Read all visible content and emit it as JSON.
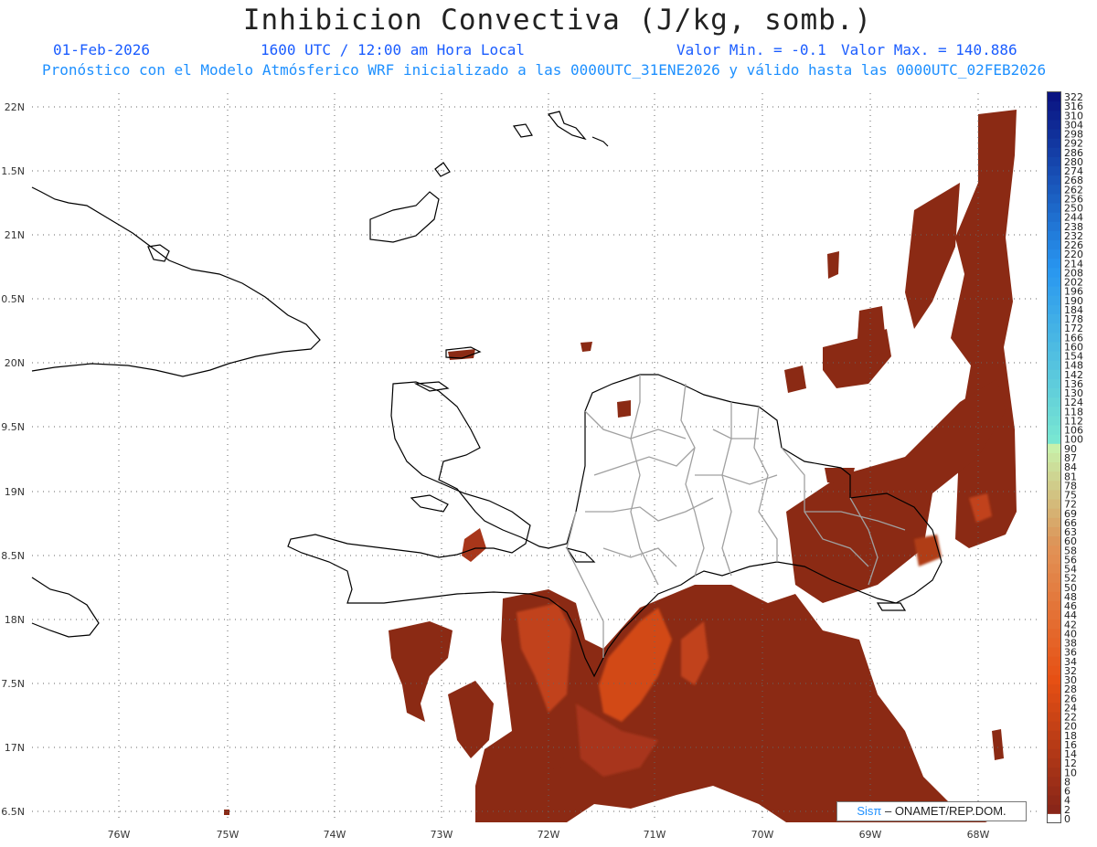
{
  "title": "Inhibicion Convectiva (J/kg, somb.)",
  "header": {
    "date": "01-Feb-2026",
    "time": "1600 UTC / 12:00 am Hora Local",
    "value_min": "Valor Min. = -0.1",
    "value_max": "Valor Max. = 140.886",
    "description": "Pronóstico con el Modelo Atmósferico WRF inicializado a las 0000UTC_31ENE2026 y válido hasta las  0000UTC_02FEB2026"
  },
  "axes": {
    "lat_labels": [
      "22N",
      "1.5N",
      "21N",
      "0.5N",
      "20N",
      "9.5N",
      "19N",
      "8.5N",
      "18N",
      "7.5N",
      "17N",
      "6.5N"
    ],
    "lon_labels": [
      "76W",
      "75W",
      "74W",
      "73W",
      "72W",
      "71W",
      "70W",
      "69W",
      "68W"
    ]
  },
  "colorbar": {
    "labels": [
      "322",
      "316",
      "310",
      "304",
      "298",
      "292",
      "286",
      "280",
      "274",
      "268",
      "262",
      "256",
      "250",
      "244",
      "238",
      "232",
      "226",
      "220",
      "214",
      "208",
      "202",
      "196",
      "190",
      "184",
      "178",
      "172",
      "166",
      "160",
      "154",
      "148",
      "142",
      "136",
      "130",
      "124",
      "118",
      "112",
      "106",
      "100",
      "90",
      "87",
      "84",
      "81",
      "78",
      "75",
      "72",
      "69",
      "66",
      "63",
      "60",
      "58",
      "56",
      "54",
      "52",
      "50",
      "48",
      "46",
      "44",
      "42",
      "40",
      "38",
      "36",
      "34",
      "32",
      "30",
      "28",
      "26",
      "24",
      "22",
      "20",
      "18",
      "16",
      "14",
      "12",
      "10",
      "8",
      "6",
      "4",
      "2",
      "0"
    ]
  },
  "credit": {
    "brand": "Sisπ",
    "text": " – ONAMET/REP.DOM."
  },
  "colors": {
    "fill_dark": "#8b2a14",
    "fill_mid": "#a8361a",
    "fill_bright": "#d24a18",
    "coast": "#000000",
    "provinces": "#a0a0a0",
    "grid": "#666666",
    "header_blue": "#1a5cff"
  }
}
